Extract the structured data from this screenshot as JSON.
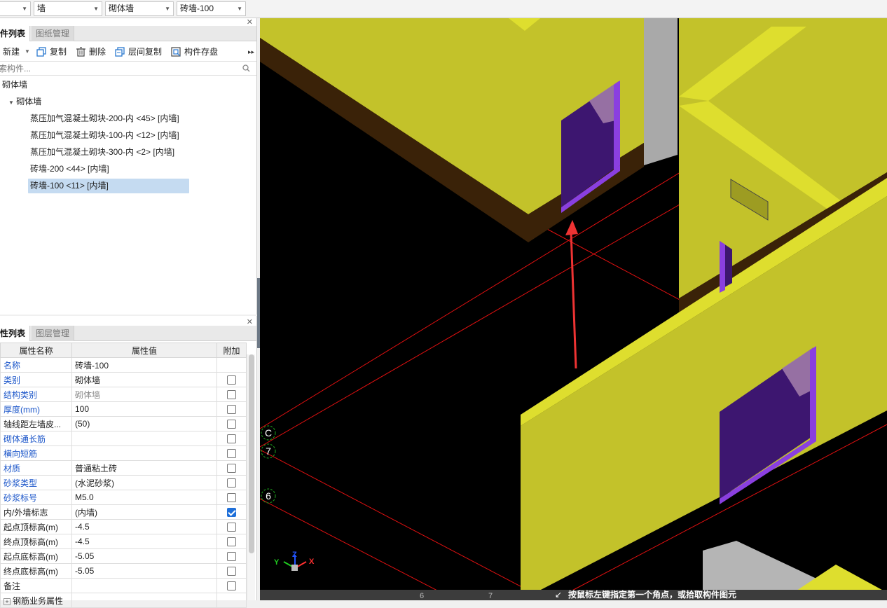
{
  "filters": {
    "combo1": "",
    "combo2": "墙",
    "combo3": "砌体墙",
    "combo4": "砖墙-100"
  },
  "components_panel": {
    "tab_active": "件列表",
    "tab_inactive": "图纸管理",
    "toolbar": {
      "new": "新建",
      "copy": "复制",
      "delete": "删除",
      "floor_copy": "层间复制",
      "save": "构件存盘"
    },
    "search_placeholder": "索构件...",
    "tree": {
      "root": "砌体墙",
      "group": "砌体墙",
      "items": [
        "蒸压加气混凝土砌块-200-内 <45> [内墙]",
        "蒸压加气混凝土砌块-100-内 <12> [内墙]",
        "蒸压加气混凝土砌块-300-内 <2> [内墙]",
        "砖墙-200 <44> [内墙]",
        "砖墙-100 <11> [内墙]"
      ],
      "selected_index": 4
    }
  },
  "properties_panel": {
    "tab_active": "性列表",
    "tab_inactive": "图层管理",
    "headers": {
      "name": "属性名称",
      "value": "属性值",
      "extra": "附加"
    },
    "rows": [
      {
        "name": "名称",
        "value": "砖墙-100",
        "blue": true,
        "checkbox": "none"
      },
      {
        "name": "类别",
        "value": "砌体墙",
        "blue": true,
        "checkbox": "off"
      },
      {
        "name": "结构类别",
        "value": "砌体墙",
        "blue": true,
        "gray": true,
        "checkbox": "off"
      },
      {
        "name": "厚度(mm)",
        "value": "100",
        "blue": true,
        "checkbox": "off"
      },
      {
        "name": "轴线距左墙皮...",
        "value": "(50)",
        "blue": false,
        "checkbox": "off"
      },
      {
        "name": "砌体通长筋",
        "value": "",
        "blue": true,
        "checkbox": "off"
      },
      {
        "name": "横向短筋",
        "value": "",
        "blue": true,
        "checkbox": "off"
      },
      {
        "name": "材质",
        "value": "普通粘土砖",
        "blue": true,
        "checkbox": "off"
      },
      {
        "name": "砂浆类型",
        "value": "(水泥砂浆)",
        "blue": true,
        "checkbox": "off"
      },
      {
        "name": "砂浆标号",
        "value": "M5.0",
        "blue": true,
        "checkbox": "off"
      },
      {
        "name": "内/外墙标志",
        "value": "(内墙)",
        "blue": false,
        "checkbox": "on"
      },
      {
        "name": "起点顶标高(m)",
        "value": "-4.5",
        "blue": false,
        "checkbox": "off"
      },
      {
        "name": "终点顶标高(m)",
        "value": "-4.5",
        "blue": false,
        "checkbox": "off"
      },
      {
        "name": "起点底标高(m)",
        "value": "-5.05",
        "blue": false,
        "checkbox": "off"
      },
      {
        "name": "终点底标高(m)",
        "value": "-5.05",
        "blue": false,
        "checkbox": "off"
      },
      {
        "name": "备注",
        "value": "",
        "blue": false,
        "checkbox": "off"
      },
      {
        "name": "钢筋业务属性",
        "value": "",
        "blue": false,
        "checkbox": "none",
        "expandable": true
      }
    ]
  },
  "viewport": {
    "axis_labels": [
      "C",
      "7",
      "6"
    ],
    "bottom_axis_labels": [
      "6",
      "7"
    ],
    "gizmo": {
      "x": "X",
      "y": "Y",
      "z": "Z"
    },
    "status_text": "按鼠标左键指定第一个角点，或拾取构件图元",
    "colors": {
      "wall": "#c3c22a",
      "wall_top": "#dede2e",
      "base": "#3a2208",
      "window": "#7a30cc",
      "grid_line": "#e01010",
      "arrow": "#ee3333"
    }
  }
}
